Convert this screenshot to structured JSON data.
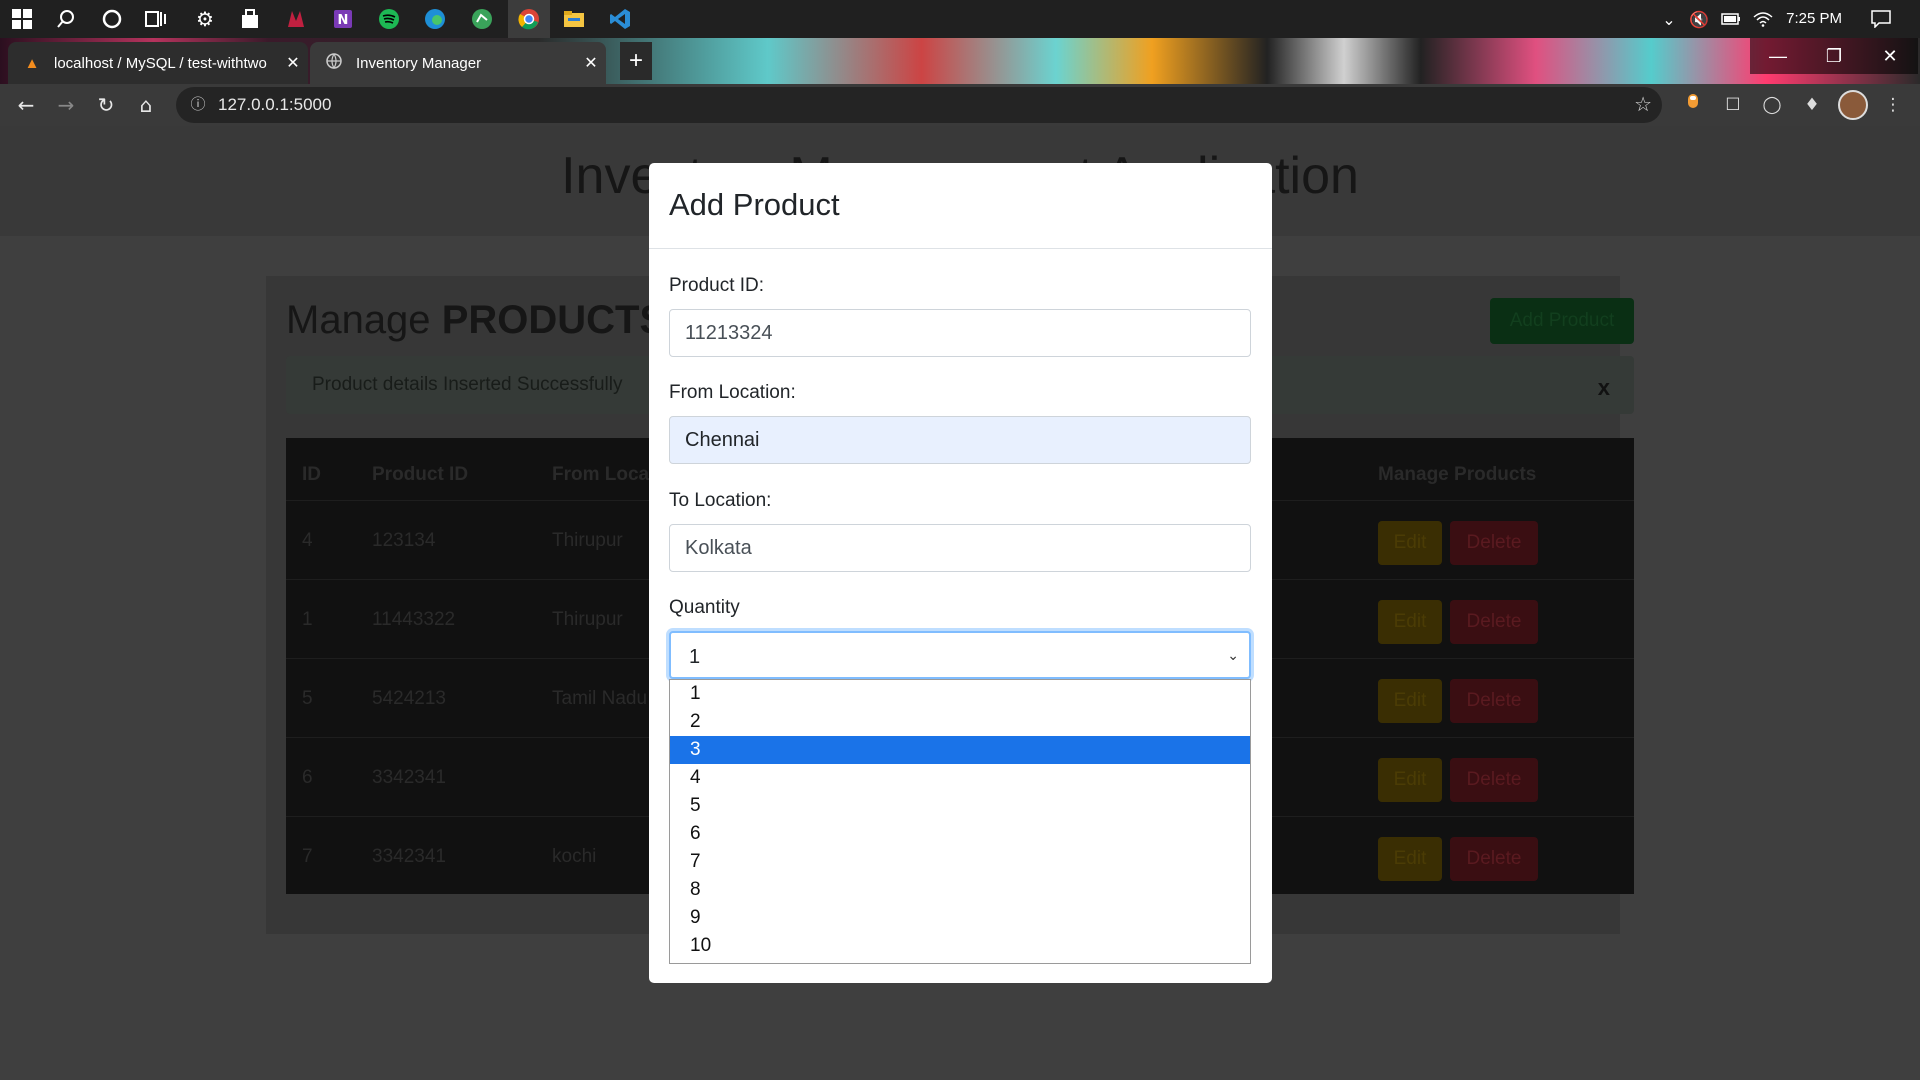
{
  "taskbar": {
    "icons": [
      "windows-start-icon",
      "search-icon",
      "cortana-icon",
      "task-view-icon",
      "settings-icon",
      "store-icon",
      "app-icon",
      "onenote-icon",
      "spotify-icon",
      "edge-icon",
      "app-icon",
      "chrome-icon",
      "file-explorer-icon",
      "vscode-icon"
    ],
    "time": "7:25 PM"
  },
  "browser": {
    "tabs": [
      {
        "label": "localhost / MySQL / test-withtwo",
        "icon": "phpmyadmin-icon"
      },
      {
        "label": "Inventory Manager",
        "icon": "globe-icon"
      }
    ],
    "url": "127.0.0.1:5000"
  },
  "page": {
    "title": "Inventory Management Application",
    "manage_prefix": "Manage",
    "manage_strong": "PRODUCTS",
    "add_button": "Add Product",
    "alert": {
      "text": "Product details Inserted Successfully",
      "close": "x"
    },
    "table": {
      "headers": [
        "ID",
        "Product ID",
        "From Location",
        "Manage Products"
      ],
      "rows": [
        {
          "id": "4",
          "product_id": "123134",
          "from": "Thirupur"
        },
        {
          "id": "1",
          "product_id": "11443322",
          "from": "Thirupur"
        },
        {
          "id": "5",
          "product_id": "5424213",
          "from": "Tamil Nadu"
        },
        {
          "id": "6",
          "product_id": "3342341",
          "from": ""
        },
        {
          "id": "7",
          "product_id": "3342341",
          "from": "kochi"
        }
      ],
      "edit_label": "Edit",
      "delete_label": "Delete"
    }
  },
  "modal": {
    "title": "Add Product",
    "product_id_label": "Product ID:",
    "product_id_value": "11213324",
    "from_label": "From Location:",
    "from_value": "Chennai",
    "to_label": "To Location:",
    "to_value": "Kolkata",
    "quantity_label": "Quantity",
    "quantity_value": "1",
    "quantity_options": [
      "1",
      "2",
      "3",
      "4",
      "5",
      "6",
      "7",
      "8",
      "9",
      "10"
    ],
    "highlighted_option": "3"
  },
  "colors": {
    "highlight": "#1a73e8",
    "focus_ring": "#80bdff",
    "autofill": "#e8f0fe"
  }
}
